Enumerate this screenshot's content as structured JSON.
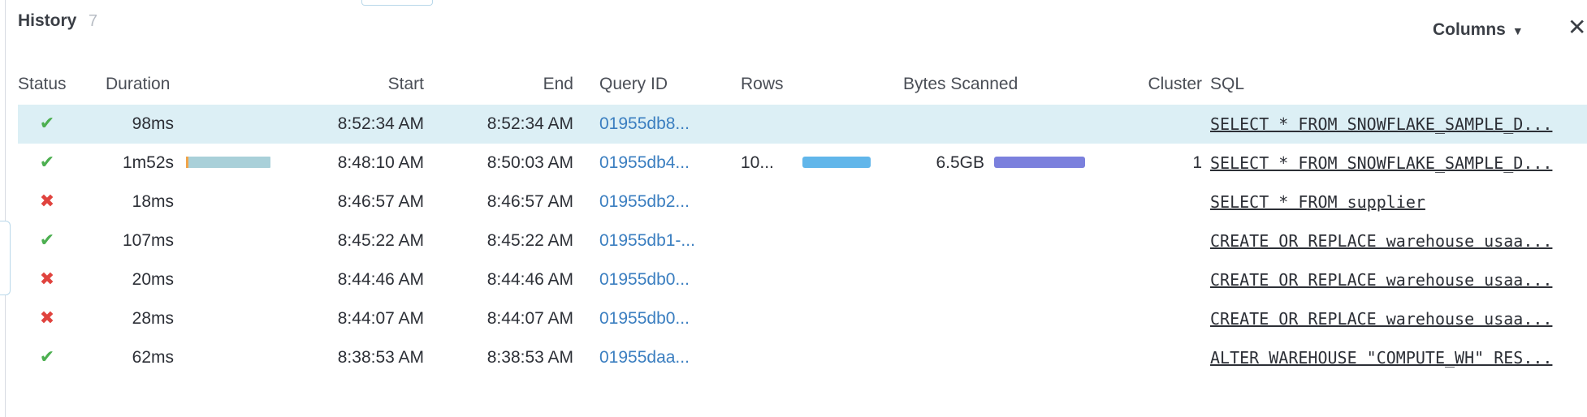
{
  "panel": {
    "title": "History",
    "count": "7",
    "columns_label": "Columns",
    "close_label": "✕"
  },
  "columns": {
    "status": "Status",
    "duration": "Duration",
    "start": "Start",
    "end": "End",
    "query_id": "Query ID",
    "rows": "Rows",
    "bytes_scanned": "Bytes Scanned",
    "cluster": "Cluster",
    "sql": "SQL"
  },
  "rows": [
    {
      "status": "success",
      "duration": "98ms",
      "start": "8:52:34 AM",
      "end": "8:52:34 AM",
      "query_id": "01955db8...",
      "rows": "",
      "bytes": "",
      "cluster": "",
      "sql": "SELECT * FROM SNOWFLAKE_SAMPLE_D..."
    },
    {
      "status": "success",
      "duration": "1m52s",
      "start": "8:48:10 AM",
      "end": "8:50:03 AM",
      "query_id": "01955db4...",
      "rows": "10...",
      "bytes": "6.5GB",
      "cluster": "1",
      "sql": "SELECT * FROM SNOWFLAKE_SAMPLE_D..."
    },
    {
      "status": "failed",
      "duration": "18ms",
      "start": "8:46:57 AM",
      "end": "8:46:57 AM",
      "query_id": "01955db2...",
      "rows": "",
      "bytes": "",
      "cluster": "",
      "sql": "SELECT * FROM supplier"
    },
    {
      "status": "success",
      "duration": "107ms",
      "start": "8:45:22 AM",
      "end": "8:45:22 AM",
      "query_id": "01955db1-...",
      "rows": "",
      "bytes": "",
      "cluster": "",
      "sql": "CREATE OR REPLACE warehouse usaa..."
    },
    {
      "status": "failed",
      "duration": "20ms",
      "start": "8:44:46 AM",
      "end": "8:44:46 AM",
      "query_id": "01955db0...",
      "rows": "",
      "bytes": "",
      "cluster": "",
      "sql": "CREATE OR REPLACE warehouse usaa..."
    },
    {
      "status": "failed",
      "duration": "28ms",
      "start": "8:44:07 AM",
      "end": "8:44:07 AM",
      "query_id": "01955db0...",
      "rows": "",
      "bytes": "",
      "cluster": "",
      "sql": "CREATE OR REPLACE warehouse usaa..."
    },
    {
      "status": "success",
      "duration": "62ms",
      "start": "8:38:53 AM",
      "end": "8:38:53 AM",
      "query_id": "01955daa...",
      "rows": "",
      "bytes": "",
      "cluster": "",
      "sql": "ALTER WAREHOUSE \"COMPUTE_WH\" RES..."
    }
  ],
  "colors": {
    "success": "#4caf50",
    "failed": "#e0433e",
    "link": "#3a7ec0",
    "selected_row": "#dceff5"
  },
  "icons": {
    "success": "check-icon",
    "failed": "x-icon",
    "columns": "caret-down-icon",
    "close": "close-icon"
  }
}
